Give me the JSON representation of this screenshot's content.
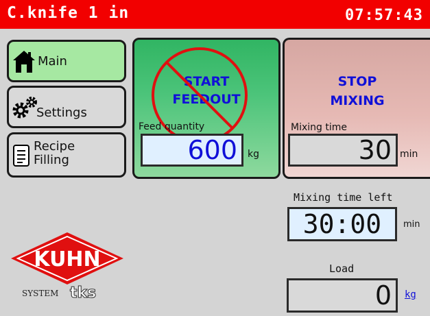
{
  "header": {
    "title": "C.knife 1 in",
    "clock": "07:57:43"
  },
  "nav": {
    "main_label": "Main",
    "settings_label": "Settings",
    "recipe_line1": "Recipe",
    "recipe_line2": "Filling"
  },
  "start_button": {
    "line1": "START",
    "line2": "FEEDOUT",
    "disabled": true,
    "feed_quantity_label": "Feed quantity",
    "feed_quantity_value": "600",
    "feed_quantity_unit": "kg"
  },
  "stop_button": {
    "line1": "STOP",
    "line2": "MIXING",
    "mixing_time_label": "Mixing time",
    "mixing_time_value": "30",
    "mixing_time_unit": "min"
  },
  "mixing_left": {
    "label": "Mixing time left",
    "value": "30:00",
    "unit": "min"
  },
  "load": {
    "label": "Load",
    "value": "0",
    "unit": "kg"
  },
  "branding": {
    "logo_text": "KUHN",
    "system_text": "SYSTEM",
    "tks_text": "tks"
  },
  "colors": {
    "titlebar": "#f20000",
    "active_nav": "#a6e8a2",
    "start_green": "#31b563",
    "stop_pink": "#e6b9b4",
    "button_text_blue": "#1010d8",
    "prohibit_red": "#e01010"
  }
}
